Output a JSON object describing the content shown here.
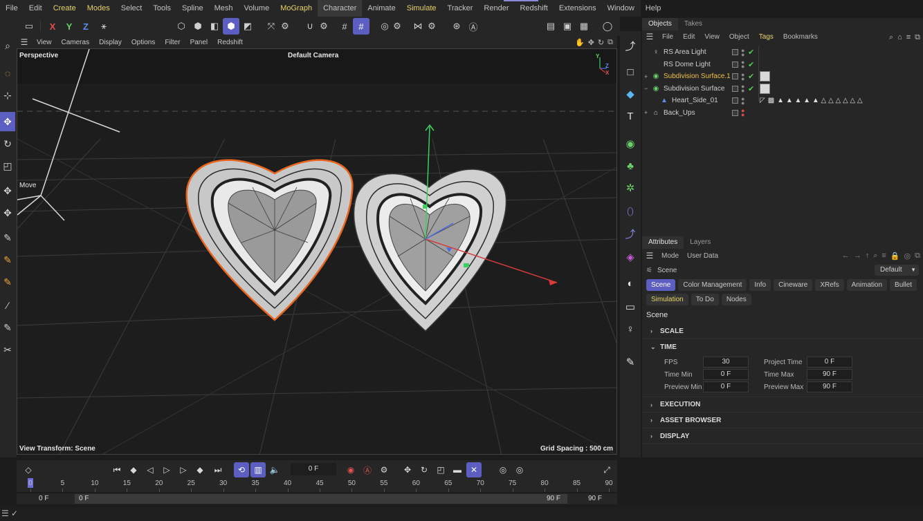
{
  "menu": {
    "items": [
      {
        "label": "File",
        "hl": false
      },
      {
        "label": "Edit",
        "hl": false
      },
      {
        "label": "Create",
        "hl": true
      },
      {
        "label": "Modes",
        "hl": true
      },
      {
        "label": "Select",
        "hl": false
      },
      {
        "label": "Tools",
        "hl": false
      },
      {
        "label": "Spline",
        "hl": false
      },
      {
        "label": "Mesh",
        "hl": false
      },
      {
        "label": "Volume",
        "hl": false
      },
      {
        "label": "MoGraph",
        "hl": true
      },
      {
        "label": "Character",
        "hl": false
      },
      {
        "label": "Animate",
        "hl": false
      },
      {
        "label": "Simulate",
        "hl": true
      },
      {
        "label": "Tracker",
        "hl": false
      },
      {
        "label": "Render",
        "hl": false
      },
      {
        "label": "Redshift",
        "hl": false
      },
      {
        "label": "Extensions",
        "hl": false
      },
      {
        "label": "Window",
        "hl": false
      },
      {
        "label": "Help",
        "hl": false
      }
    ]
  },
  "axis_buttons": {
    "x": "X",
    "y": "Y",
    "z": "Z"
  },
  "viewport": {
    "menu": [
      "View",
      "Cameras",
      "Display",
      "Options",
      "Filter",
      "Panel",
      "Redshift"
    ],
    "label_perspective": "Perspective",
    "label_camera": "Default Camera",
    "label_move": "Move",
    "label_transform": "View Transform: Scene",
    "label_grid": "Grid Spacing : 500 cm",
    "axis_y": "Y",
    "axis_z": "Z",
    "axis_x": "X"
  },
  "objects": {
    "tabs": [
      "Objects",
      "Takes"
    ],
    "menu": [
      {
        "label": "File",
        "hl": false
      },
      {
        "label": "Edit",
        "hl": false
      },
      {
        "label": "View",
        "hl": false
      },
      {
        "label": "Object",
        "hl": false
      },
      {
        "label": "Tags",
        "hl": true
      },
      {
        "label": "Bookmarks",
        "hl": false
      }
    ],
    "rows": [
      {
        "name": "RS Area Light",
        "icon": "area-light-icon",
        "glyph": "♀",
        "expand": "",
        "highlight": false,
        "check": true,
        "dots_red": false,
        "thumb": false
      },
      {
        "name": "RS Dome Light",
        "icon": "dome-light-icon",
        "glyph": "",
        "expand": "",
        "highlight": false,
        "check": true,
        "dots_red": false,
        "thumb": false
      },
      {
        "name": "Subdivision Surface.1",
        "icon": "subdivision-surface-icon",
        "glyph": "◉",
        "expand": "+",
        "highlight": true,
        "check": true,
        "dots_red": false,
        "thumb": true
      },
      {
        "name": "Subdivision Surface",
        "icon": "subdivision-surface-icon",
        "glyph": "◉",
        "expand": "−",
        "highlight": false,
        "check": true,
        "dots_red": false,
        "thumb": true
      },
      {
        "name": "Heart_Side_01",
        "icon": "polygon-object-icon",
        "glyph": "▲",
        "expand": "",
        "highlight": false,
        "check": false,
        "dots_red": false,
        "thumb": false,
        "tags": true
      },
      {
        "name": "Back_Ups",
        "icon": "null-group-icon",
        "glyph": "⌂",
        "expand": "+",
        "highlight": false,
        "check": false,
        "dots_red": true,
        "thumb": false
      }
    ]
  },
  "attributes": {
    "tabs": [
      "Attributes",
      "Layers"
    ],
    "menu": [
      "Mode",
      "User Data"
    ],
    "scene_label": "Scene",
    "dropdown": "Default",
    "buttons_row1": [
      "Scene",
      "Color Management",
      "Info",
      "Cineware",
      "XRefs",
      "Animation",
      "Bullet"
    ],
    "buttons_row2": [
      "Simulation",
      "To Do",
      "Nodes"
    ],
    "title": "Scene",
    "sections": {
      "scale": "SCALE",
      "time": "TIME",
      "execution": "EXECUTION",
      "asset_browser": "ASSET BROWSER",
      "display": "DISPLAY"
    },
    "time_fields": {
      "fps_label": "FPS",
      "fps": "30",
      "project_time_label": "Project Time",
      "project_time": "0 F",
      "time_min_label": "Time Min",
      "time_min": "0 F",
      "time_max_label": "Time Max",
      "time_max": "90 F",
      "preview_min_label": "Preview Min",
      "preview_min": "0 F",
      "preview_max_label": "Preview Max",
      "preview_max": "90 F"
    }
  },
  "timeline": {
    "current_frame": "0 F",
    "ticks": [
      "0",
      "5",
      "10",
      "15",
      "20",
      "25",
      "30",
      "35",
      "40",
      "45",
      "50",
      "55",
      "60",
      "65",
      "70",
      "75",
      "80",
      "85",
      "90"
    ],
    "range_start_outer": "0 F",
    "range_start_inner": "0 F",
    "range_end_inner": "90 F",
    "range_end_outer": "90 F"
  },
  "colors": {
    "accent": "#5c5ec2",
    "highlight_text": "#e8d46a",
    "selection_outline": "#e8651e",
    "check_green": "#4fd04f"
  }
}
